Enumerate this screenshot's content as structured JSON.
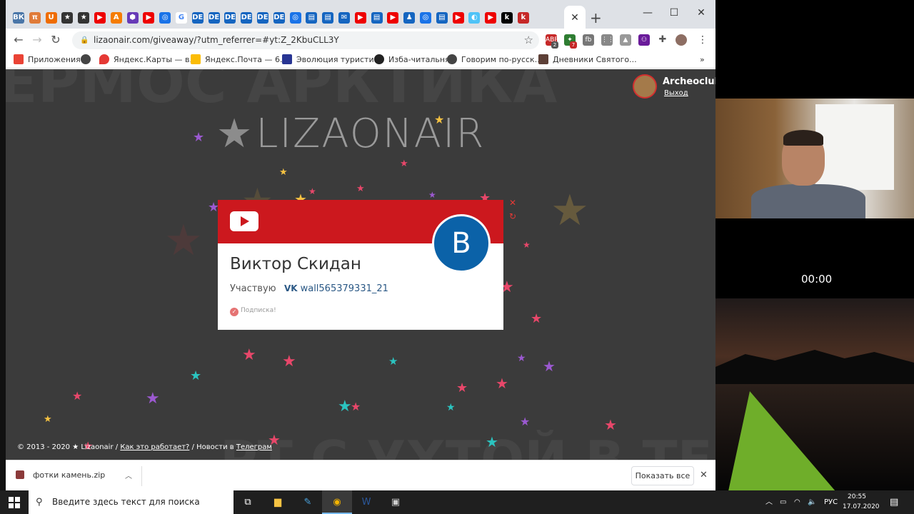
{
  "browser": {
    "url": "lizaonair.com/giveaway/?utm_referrer=#yt:Z_2KbuCLL3Y",
    "active_tab_close": "✕",
    "new_tab": "+",
    "window_controls": [
      "—",
      "☐",
      "✕"
    ],
    "extension_badges": [
      "2",
      "7"
    ],
    "tab_favicons": [
      "ВК",
      "π",
      "U",
      "★",
      "★",
      "▶",
      "A",
      "⬢",
      "▶",
      "◎",
      "G",
      "DE",
      "DE",
      "DE",
      "DE",
      "DE",
      "DE",
      "◎",
      "▤",
      "▤",
      "✉",
      "▶",
      "▤",
      "▶",
      "♟",
      "◎",
      "▤",
      "▶",
      "◐",
      "▶",
      "k",
      "k"
    ],
    "tab_colors": [
      "#4a76a8",
      "#e07b39",
      "#ef6c00",
      "#333",
      "#333",
      "#e00",
      "#f57c00",
      "#673ab7",
      "#e00",
      "#1a73e8",
      "#fff",
      "#1565c0",
      "#1565c0",
      "#1565c0",
      "#1565c0",
      "#1565c0",
      "#1565c0",
      "#1a73e8",
      "#1565c0",
      "#1565c0",
      "#1565c0",
      "#e00",
      "#1565c0",
      "#e00",
      "#1565c0",
      "#1a73e8",
      "#1565c0",
      "#e00",
      "#4fc3f7",
      "#e00",
      "#000",
      "#c62828"
    ]
  },
  "bookmarks": [
    {
      "label": "Приложения",
      "color": "#ea4335"
    },
    {
      "label": "",
      "color": "#444"
    },
    {
      "label": "Яндекс.Карты — в...",
      "color": "#e53935"
    },
    {
      "label": "Яндекс.Почта — 6...",
      "color": "#fbbc05"
    },
    {
      "label": "Эволюция туристи...",
      "color": "#283593"
    },
    {
      "label": "Изба-читальня",
      "color": "#222"
    },
    {
      "label": "Говорим по-русск...",
      "color": "#444"
    },
    {
      "label": "Дневники Святого...",
      "color": "#5d4037"
    },
    {
      "label": "»",
      "color": ""
    }
  ],
  "page": {
    "logo_text": "LIZAONAIR",
    "bg_text_top": "ЕРМОС АРКТИКА",
    "bg_text_bottom": "РТ С УХТОЙ В ТЕРУС",
    "user_name": "Archeoclub",
    "logout": "Выход",
    "card": {
      "avatar_letter": "B",
      "name": "Виктор Скидан",
      "participating": "Участвую",
      "vk_link": "wall565379331_21",
      "subscribed": "Подписка!"
    },
    "footer": {
      "copyright": "© 2013 - 2020 ★ Lizaonair /",
      "how_it_works": "Как это работает?",
      "news": "/ Новости в",
      "telegram": "Телеграм"
    }
  },
  "downloads": {
    "file": "фотки камень.zip",
    "show_all": "Показать все"
  },
  "webcam": {
    "timer": "00:00"
  },
  "taskbar": {
    "search_placeholder": "Введите здесь текст для поиска",
    "lang": "РУС",
    "time": "20:55",
    "date": "17.07.2020"
  }
}
